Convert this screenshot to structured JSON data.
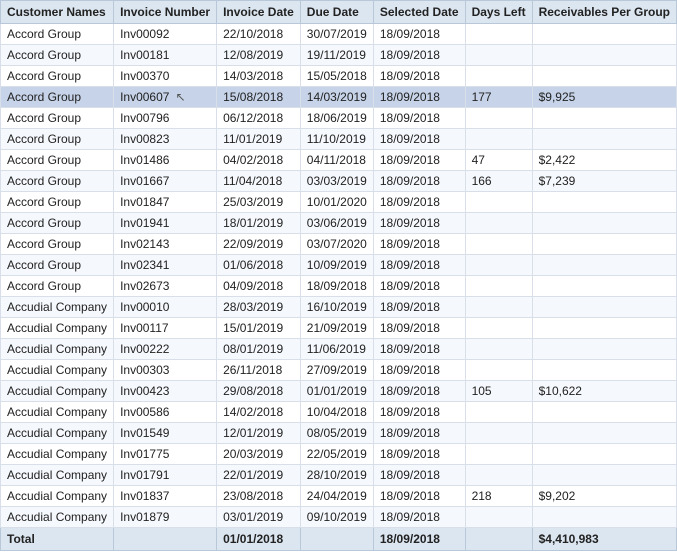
{
  "table": {
    "columns": [
      "Customer Names",
      "Invoice Number",
      "Invoice Date",
      "Due Date",
      "Selected Date",
      "Days Left",
      "Receivables Per Group"
    ],
    "rows": [
      {
        "customer": "Accord Group",
        "invoice": "Inv00092",
        "invoice_date": "22/10/2018",
        "due_date": "30/07/2019",
        "selected_date": "18/09/2018",
        "days_left": "",
        "receivables": "",
        "highlight": false,
        "cursor": false
      },
      {
        "customer": "Accord Group",
        "invoice": "Inv00181",
        "invoice_date": "12/08/2019",
        "due_date": "19/11/2019",
        "selected_date": "18/09/2018",
        "days_left": "",
        "receivables": "",
        "highlight": false,
        "cursor": false
      },
      {
        "customer": "Accord Group",
        "invoice": "Inv00370",
        "invoice_date": "14/03/2018",
        "due_date": "15/05/2018",
        "selected_date": "18/09/2018",
        "days_left": "",
        "receivables": "",
        "highlight": false,
        "cursor": false
      },
      {
        "customer": "Accord Group",
        "invoice": "Inv00607",
        "invoice_date": "15/08/2018",
        "due_date": "14/03/2019",
        "selected_date": "18/09/2018",
        "days_left": "177",
        "receivables": "$9,925",
        "highlight": true,
        "cursor": true
      },
      {
        "customer": "Accord Group",
        "invoice": "Inv00796",
        "invoice_date": "06/12/2018",
        "due_date": "18/06/2019",
        "selected_date": "18/09/2018",
        "days_left": "",
        "receivables": "",
        "highlight": false,
        "cursor": false
      },
      {
        "customer": "Accord Group",
        "invoice": "Inv00823",
        "invoice_date": "11/01/2019",
        "due_date": "11/10/2019",
        "selected_date": "18/09/2018",
        "days_left": "",
        "receivables": "",
        "highlight": false,
        "cursor": false
      },
      {
        "customer": "Accord Group",
        "invoice": "Inv01486",
        "invoice_date": "04/02/2018",
        "due_date": "04/11/2018",
        "selected_date": "18/09/2018",
        "days_left": "47",
        "receivables": "$2,422",
        "highlight": false,
        "cursor": false
      },
      {
        "customer": "Accord Group",
        "invoice": "Inv01667",
        "invoice_date": "11/04/2018",
        "due_date": "03/03/2019",
        "selected_date": "18/09/2018",
        "days_left": "166",
        "receivables": "$7,239",
        "highlight": false,
        "cursor": false
      },
      {
        "customer": "Accord Group",
        "invoice": "Inv01847",
        "invoice_date": "25/03/2019",
        "due_date": "10/01/2020",
        "selected_date": "18/09/2018",
        "days_left": "",
        "receivables": "",
        "highlight": false,
        "cursor": false
      },
      {
        "customer": "Accord Group",
        "invoice": "Inv01941",
        "invoice_date": "18/01/2019",
        "due_date": "03/06/2019",
        "selected_date": "18/09/2018",
        "days_left": "",
        "receivables": "",
        "highlight": false,
        "cursor": false
      },
      {
        "customer": "Accord Group",
        "invoice": "Inv02143",
        "invoice_date": "22/09/2019",
        "due_date": "03/07/2020",
        "selected_date": "18/09/2018",
        "days_left": "",
        "receivables": "",
        "highlight": false,
        "cursor": false
      },
      {
        "customer": "Accord Group",
        "invoice": "Inv02341",
        "invoice_date": "01/06/2018",
        "due_date": "10/09/2019",
        "selected_date": "18/09/2018",
        "days_left": "",
        "receivables": "",
        "highlight": false,
        "cursor": false
      },
      {
        "customer": "Accord Group",
        "invoice": "Inv02673",
        "invoice_date": "04/09/2018",
        "due_date": "18/09/2018",
        "selected_date": "18/09/2018",
        "days_left": "",
        "receivables": "",
        "highlight": false,
        "cursor": false
      },
      {
        "customer": "Accudial Company",
        "invoice": "Inv00010",
        "invoice_date": "28/03/2019",
        "due_date": "16/10/2019",
        "selected_date": "18/09/2018",
        "days_left": "",
        "receivables": "",
        "highlight": false,
        "cursor": false
      },
      {
        "customer": "Accudial Company",
        "invoice": "Inv00117",
        "invoice_date": "15/01/2019",
        "due_date": "21/09/2019",
        "selected_date": "18/09/2018",
        "days_left": "",
        "receivables": "",
        "highlight": false,
        "cursor": false
      },
      {
        "customer": "Accudial Company",
        "invoice": "Inv00222",
        "invoice_date": "08/01/2019",
        "due_date": "11/06/2019",
        "selected_date": "18/09/2018",
        "days_left": "",
        "receivables": "",
        "highlight": false,
        "cursor": false
      },
      {
        "customer": "Accudial Company",
        "invoice": "Inv00303",
        "invoice_date": "26/11/2018",
        "due_date": "27/09/2019",
        "selected_date": "18/09/2018",
        "days_left": "",
        "receivables": "",
        "highlight": false,
        "cursor": false
      },
      {
        "customer": "Accudial Company",
        "invoice": "Inv00423",
        "invoice_date": "29/08/2018",
        "due_date": "01/01/2019",
        "selected_date": "18/09/2018",
        "days_left": "105",
        "receivables": "$10,622",
        "highlight": false,
        "cursor": false
      },
      {
        "customer": "Accudial Company",
        "invoice": "Inv00586",
        "invoice_date": "14/02/2018",
        "due_date": "10/04/2018",
        "selected_date": "18/09/2018",
        "days_left": "",
        "receivables": "",
        "highlight": false,
        "cursor": false
      },
      {
        "customer": "Accudial Company",
        "invoice": "Inv01549",
        "invoice_date": "12/01/2019",
        "due_date": "08/05/2019",
        "selected_date": "18/09/2018",
        "days_left": "",
        "receivables": "",
        "highlight": false,
        "cursor": false
      },
      {
        "customer": "Accudial Company",
        "invoice": "Inv01775",
        "invoice_date": "20/03/2019",
        "due_date": "22/05/2019",
        "selected_date": "18/09/2018",
        "days_left": "",
        "receivables": "",
        "highlight": false,
        "cursor": false
      },
      {
        "customer": "Accudial Company",
        "invoice": "Inv01791",
        "invoice_date": "22/01/2019",
        "due_date": "28/10/2019",
        "selected_date": "18/09/2018",
        "days_left": "",
        "receivables": "",
        "highlight": false,
        "cursor": false
      },
      {
        "customer": "Accudial Company",
        "invoice": "Inv01837",
        "invoice_date": "23/08/2018",
        "due_date": "24/04/2019",
        "selected_date": "18/09/2018",
        "days_left": "218",
        "receivables": "$9,202",
        "highlight": false,
        "cursor": false
      },
      {
        "customer": "Accudial Company",
        "invoice": "Inv01879",
        "invoice_date": "03/01/2019",
        "due_date": "09/10/2019",
        "selected_date": "18/09/2018",
        "days_left": "",
        "receivables": "",
        "highlight": false,
        "cursor": false
      }
    ],
    "footer": {
      "label": "Total",
      "invoice_date": "01/01/2018",
      "selected_date": "18/09/2018",
      "receivables": "$4,410,983"
    }
  }
}
